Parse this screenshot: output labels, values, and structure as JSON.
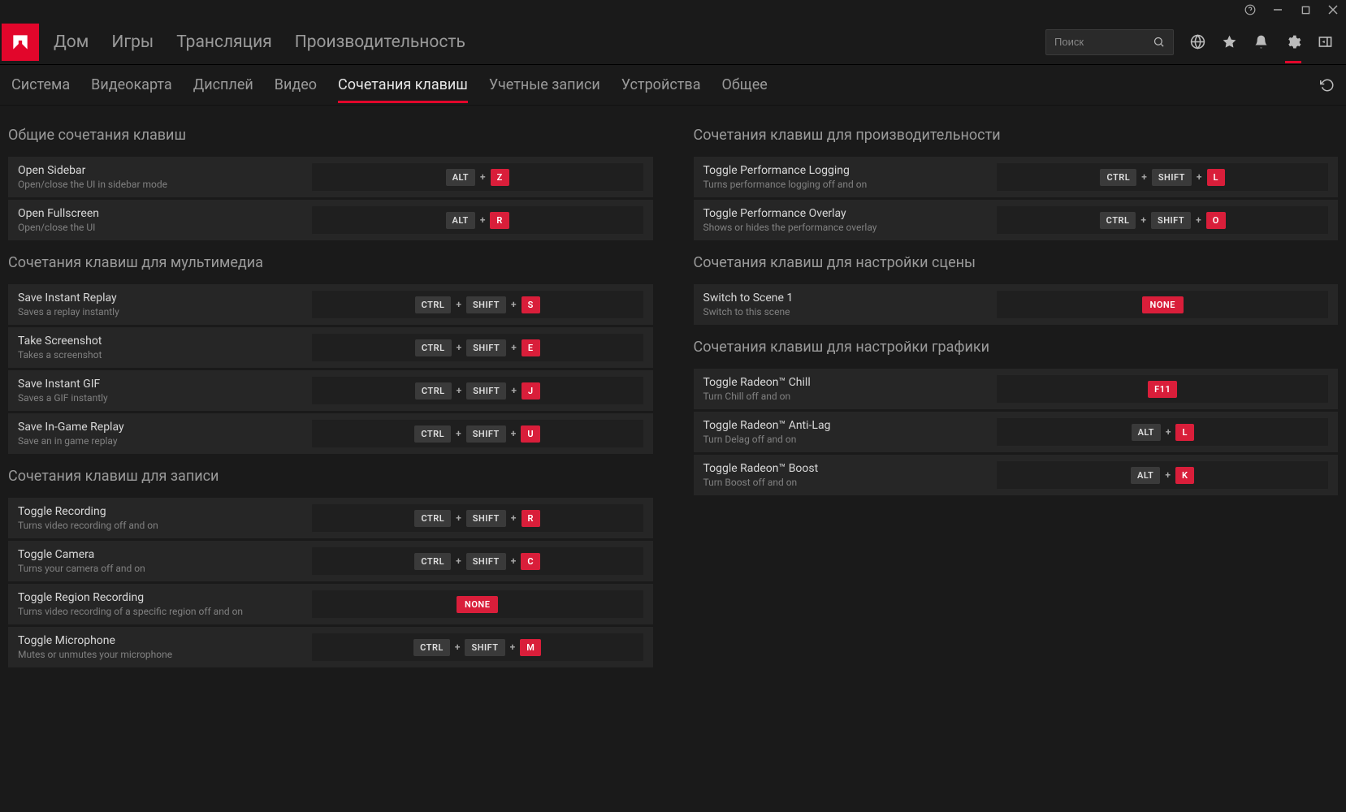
{
  "titlebar": {
    "help": "?",
    "min": "—",
    "max": "□",
    "close": "✕"
  },
  "nav": {
    "items": [
      "Дом",
      "Игры",
      "Трансляция",
      "Производительность"
    ]
  },
  "search": {
    "placeholder": "Поиск"
  },
  "subnav": {
    "items": [
      "Система",
      "Видеокарта",
      "Дисплей",
      "Видео",
      "Сочетания клавиш",
      "Учетные записи",
      "Устройства",
      "Общее"
    ],
    "activeIndex": 4
  },
  "left": {
    "sections": [
      {
        "title": "Общие сочетания клавиш",
        "rows": [
          {
            "title": "Open Sidebar",
            "desc": "Open/close the UI in sidebar mode",
            "keys": [
              "ALT"
            ],
            "final": "Z"
          },
          {
            "title": "Open Fullscreen",
            "desc": "Open/close the UI",
            "keys": [
              "ALT"
            ],
            "final": "R"
          }
        ]
      },
      {
        "title": "Сочетания клавиш для мультимедиа",
        "rows": [
          {
            "title": "Save Instant Replay",
            "desc": "Saves a replay instantly",
            "keys": [
              "CTRL",
              "SHIFT"
            ],
            "final": "S"
          },
          {
            "title": "Take Screenshot",
            "desc": "Takes a screenshot",
            "keys": [
              "CTRL",
              "SHIFT"
            ],
            "final": "E"
          },
          {
            "title": "Save Instant GIF",
            "desc": "Saves a GIF instantly",
            "keys": [
              "CTRL",
              "SHIFT"
            ],
            "final": "J"
          },
          {
            "title": "Save In-Game Replay",
            "desc": "Save an in game replay",
            "keys": [
              "CTRL",
              "SHIFT"
            ],
            "final": "U"
          }
        ]
      },
      {
        "title": "Сочетания клавиш для записи",
        "rows": [
          {
            "title": "Toggle Recording",
            "desc": "Turns video recording off and on",
            "keys": [
              "CTRL",
              "SHIFT"
            ],
            "final": "R"
          },
          {
            "title": "Toggle Camera",
            "desc": "Turns your camera off and on",
            "keys": [
              "CTRL",
              "SHIFT"
            ],
            "final": "C"
          },
          {
            "title": "Toggle Region Recording",
            "desc": "Turns video recording of a specific region off and on",
            "none": "NONE"
          },
          {
            "title": "Toggle Microphone",
            "desc": "Mutes or unmutes your microphone",
            "keys": [
              "CTRL",
              "SHIFT"
            ],
            "final": "M"
          }
        ]
      }
    ]
  },
  "right": {
    "sections": [
      {
        "title": "Сочетания клавиш для производительности",
        "rows": [
          {
            "title": "Toggle Performance Logging",
            "desc": "Turns performance logging off and on",
            "keys": [
              "CTRL",
              "SHIFT"
            ],
            "final": "L"
          },
          {
            "title": "Toggle Performance Overlay",
            "desc": "Shows or hides the performance overlay",
            "keys": [
              "CTRL",
              "SHIFT"
            ],
            "final": "O"
          }
        ]
      },
      {
        "title": "Сочетания клавиш для настройки сцены",
        "rows": [
          {
            "title": "Switch to Scene 1",
            "desc": "Switch to this scene",
            "none": "NONE"
          }
        ]
      },
      {
        "title": "Сочетания клавиш для настройки графики",
        "rows": [
          {
            "title": "Toggle Radeon™ Chill",
            "desc": "Turn Chill off and on",
            "final": "F11"
          },
          {
            "title": "Toggle Radeon™ Anti-Lag",
            "desc": "Turn Delag off and on",
            "keys": [
              "ALT"
            ],
            "final": "L"
          },
          {
            "title": "Toggle Radeon™ Boost",
            "desc": "Turn Boost off and on",
            "keys": [
              "ALT"
            ],
            "final": "K"
          }
        ]
      }
    ]
  }
}
